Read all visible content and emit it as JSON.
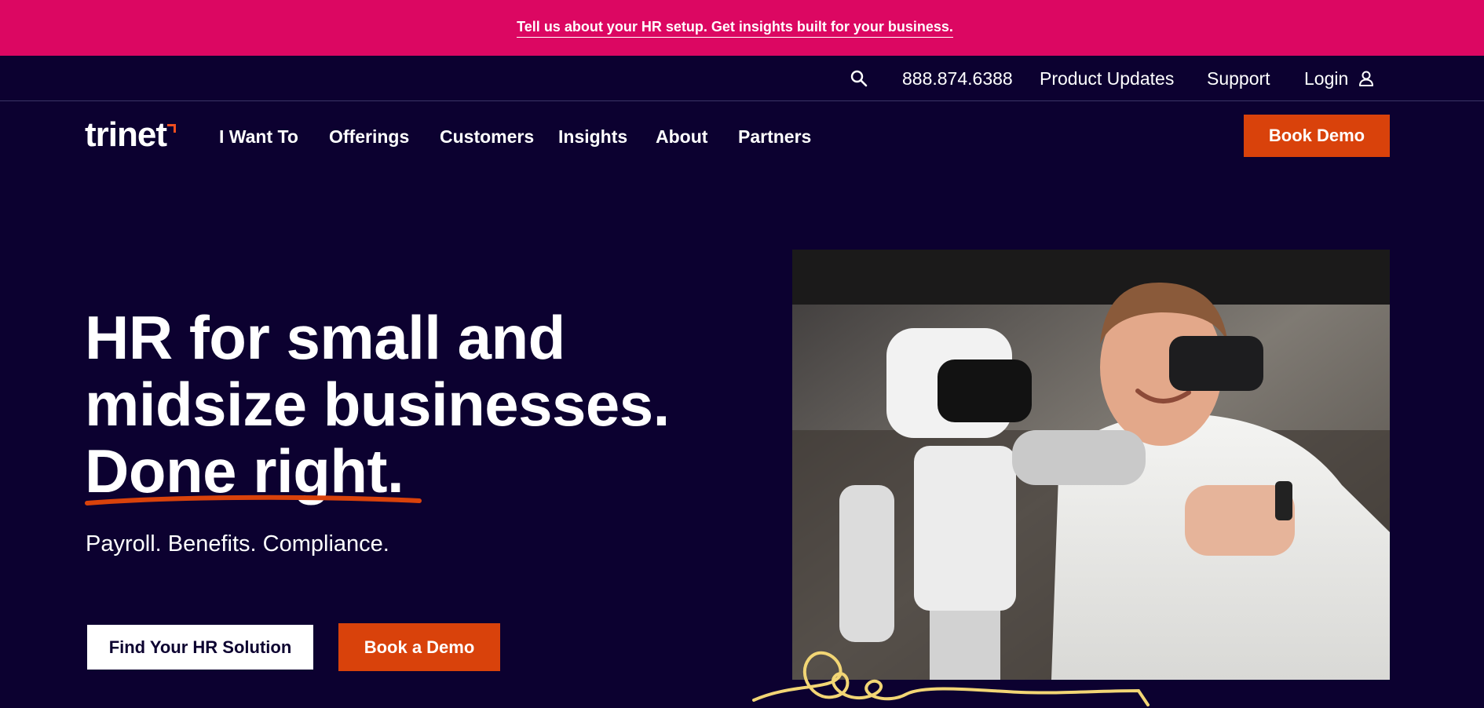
{
  "promo": {
    "text": "Tell us about your HR setup. Get insights built for your business."
  },
  "utility": {
    "phone": "888.874.6388",
    "product_updates": "Product Updates",
    "support": "Support",
    "login": "Login",
    "icons": {
      "search": "search-icon",
      "user": "user-icon"
    }
  },
  "nav": {
    "logo": "trinet",
    "items": [
      {
        "label": "I Want To"
      },
      {
        "label": "Offerings"
      },
      {
        "label": "Customers"
      },
      {
        "label": "Insights"
      },
      {
        "label": "About"
      },
      {
        "label": "Partners"
      }
    ],
    "cta": "Book Demo"
  },
  "hero": {
    "title_lines": [
      "HR for small and",
      "midsize businesses.",
      "Done right."
    ],
    "subtitle": "Payroll. Benefits. Compliance.",
    "primary_button": "Find Your HR Solution",
    "secondary_button": "Book a Demo"
  },
  "colors": {
    "promo_bg": "#dc0762",
    "page_bg": "#0c0130",
    "accent_orange": "#d9420b",
    "squiggle_yellow": "#f2d675"
  }
}
